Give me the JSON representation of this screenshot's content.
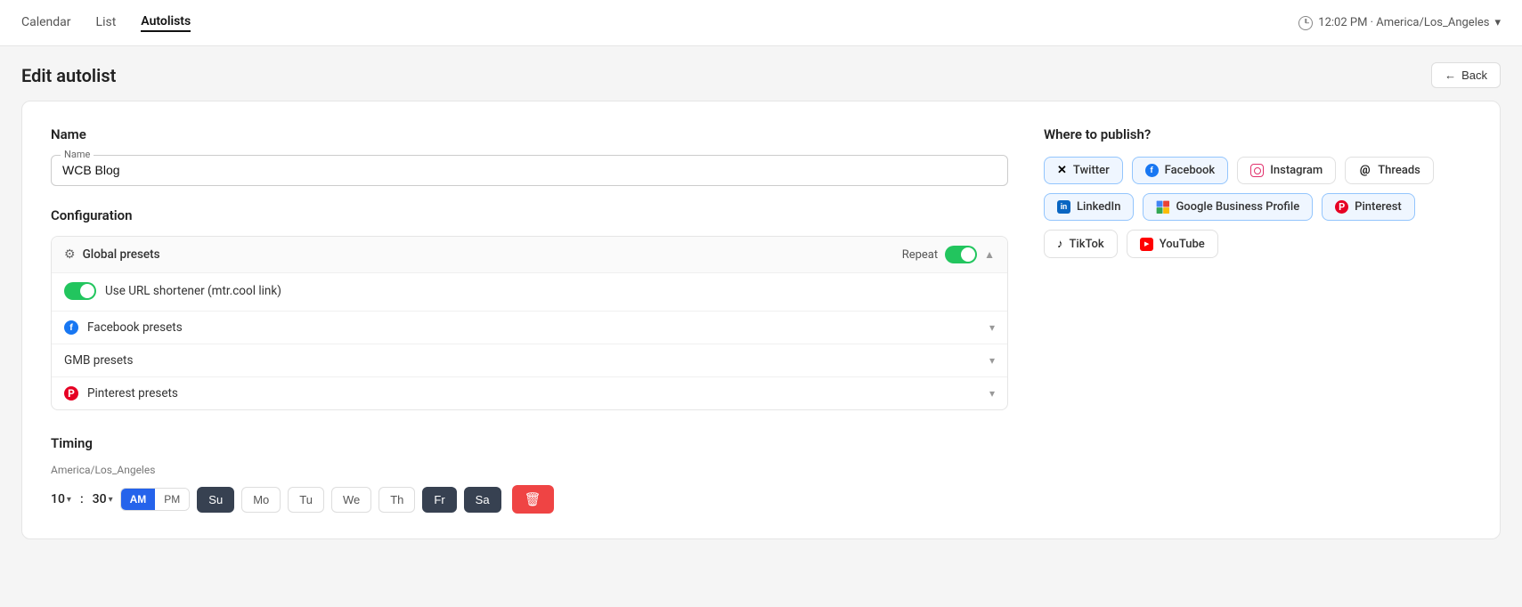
{
  "nav": {
    "items": [
      {
        "id": "calendar",
        "label": "Calendar",
        "active": false
      },
      {
        "id": "list",
        "label": "List",
        "active": false
      },
      {
        "id": "autolists",
        "label": "Autolists",
        "active": true
      }
    ],
    "timezone": "12:02 PM · America/Los_Angeles"
  },
  "page": {
    "title": "Edit autolist",
    "back_label": "Back"
  },
  "form": {
    "name_label": "Name",
    "name_value": "WCB Blog",
    "name_placeholder": "Name"
  },
  "configuration": {
    "label": "Configuration",
    "global_presets_label": "Global presets",
    "repeat_label": "Repeat",
    "repeat_on": true,
    "url_shortener_label": "Use URL shortener (mtr.cool link)",
    "url_shortener_on": true,
    "presets": [
      {
        "id": "facebook",
        "label": "Facebook presets",
        "icon": "facebook"
      },
      {
        "id": "gmb",
        "label": "GMB presets",
        "icon": null
      },
      {
        "id": "pinterest",
        "label": "Pinterest presets",
        "icon": "pinterest"
      }
    ]
  },
  "publish": {
    "label": "Where to publish?",
    "platforms": [
      {
        "id": "twitter",
        "label": "Twitter",
        "icon": "twitter",
        "selected": true
      },
      {
        "id": "facebook",
        "label": "Facebook",
        "icon": "facebook",
        "selected": true
      },
      {
        "id": "instagram",
        "label": "Instagram",
        "icon": "instagram",
        "selected": false
      },
      {
        "id": "threads",
        "label": "Threads",
        "icon": "threads",
        "selected": false
      },
      {
        "id": "linkedin",
        "label": "LinkedIn",
        "icon": "linkedin",
        "selected": true
      },
      {
        "id": "gbp",
        "label": "Google Business Profile",
        "icon": "gbp",
        "selected": true
      },
      {
        "id": "pinterest",
        "label": "Pinterest",
        "icon": "pinterest",
        "selected": true
      },
      {
        "id": "tiktok",
        "label": "TikTok",
        "icon": "tiktok",
        "selected": false
      },
      {
        "id": "youtube",
        "label": "YouTube",
        "icon": "youtube",
        "selected": false
      }
    ]
  },
  "timing": {
    "label": "Timing",
    "timezone_label": "America/Los_Angeles",
    "hour": "10",
    "minute": "30",
    "am_active": true,
    "pm_active": false,
    "am_label": "AM",
    "pm_label": "PM",
    "days": [
      {
        "id": "su",
        "label": "Su",
        "active": true
      },
      {
        "id": "mo",
        "label": "Mo",
        "active": false
      },
      {
        "id": "tu",
        "label": "Tu",
        "active": false
      },
      {
        "id": "we",
        "label": "We",
        "active": false
      },
      {
        "id": "th",
        "label": "Th",
        "active": false
      },
      {
        "id": "fr",
        "label": "Fr",
        "active": true
      },
      {
        "id": "sa",
        "label": "Sa",
        "active": true
      }
    ]
  }
}
